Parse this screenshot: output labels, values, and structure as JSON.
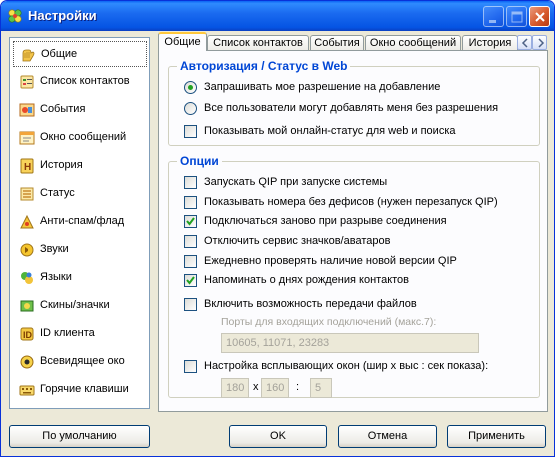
{
  "window": {
    "title": "Настройки",
    "icon": "qip-flower-icon",
    "controls": [
      "minimize",
      "maximize",
      "close"
    ]
  },
  "sidebar": {
    "items": [
      {
        "label": "Общие",
        "icon": "settings-hands-icon",
        "selected": true
      },
      {
        "label": "Список контактов",
        "icon": "contacts-list-icon",
        "selected": false
      },
      {
        "label": "События",
        "icon": "events-icon",
        "selected": false
      },
      {
        "label": "Окно сообщений",
        "icon": "message-window-icon",
        "selected": false
      },
      {
        "label": "История",
        "icon": "history-icon",
        "selected": false
      },
      {
        "label": "Статус",
        "icon": "status-icon",
        "selected": false
      },
      {
        "label": "Анти-спам/флад",
        "icon": "antispam-icon",
        "selected": false
      },
      {
        "label": "Звуки",
        "icon": "sounds-icon",
        "selected": false
      },
      {
        "label": "Языки",
        "icon": "languages-icon",
        "selected": false
      },
      {
        "label": "Скины/значки",
        "icon": "skins-icon",
        "selected": false
      },
      {
        "label": "ID клиента",
        "icon": "client-id-icon",
        "selected": false
      },
      {
        "label": "Всевидящее око",
        "icon": "all-seeing-eye-icon",
        "selected": false
      },
      {
        "label": "Горячие клавиши",
        "icon": "hotkeys-icon",
        "selected": false
      }
    ]
  },
  "tabs": [
    {
      "label": "Общие",
      "active": true
    },
    {
      "label": "Список контактов",
      "active": false
    },
    {
      "label": "События",
      "active": false
    },
    {
      "label": "Окно сообщений",
      "active": false
    },
    {
      "label": "История",
      "active": false
    }
  ],
  "auth_group": {
    "title": "Авторизация / Статус в Web",
    "radio_ask": {
      "label": "Запрашивать мое разрешение на добавление",
      "checked": true
    },
    "radio_all": {
      "label": "Все пользователи могут добавлять меня без разрешения",
      "checked": false
    },
    "show_status": {
      "label": "Показывать мой онлайн-статус для web и поиска",
      "checked": false
    }
  },
  "options_group": {
    "title": "Опции",
    "checkboxes": [
      {
        "label": "Запускать QIP при запуске системы",
        "checked": false
      },
      {
        "label": "Показывать номера без дефисов (нужен перезапуск QIP)",
        "checked": false
      },
      {
        "label": "Подключаться заново при разрыве соединения",
        "checked": true
      },
      {
        "label": "Отключить сервис значков/аватаров",
        "checked": false
      },
      {
        "label": "Ежедневно проверять наличие новой версии QIP",
        "checked": false
      },
      {
        "label": "Напоминать о днях рождения контактов",
        "checked": true
      },
      {
        "label": "Включить возможность передачи файлов",
        "checked": false
      }
    ],
    "ports_label": "Порты для входящих подключений (макс.7):",
    "ports_value": "10605, 11071, 23283",
    "popup": {
      "label": "Настройка всплывающих окон (шир x выс : сек показа):",
      "checked": false,
      "width": "180",
      "x_sep": "x",
      "height": "160",
      "colon": ":",
      "seconds": "5"
    }
  },
  "buttons": {
    "defaults": "По умолчанию",
    "ok": "OK",
    "cancel": "Отмена",
    "apply": "Применить"
  },
  "colors": {
    "titlebar": "#0A5EEF",
    "group_title": "#0046D5",
    "check_mark": "#21A121",
    "tab_active_accent": "#FFC83C"
  }
}
